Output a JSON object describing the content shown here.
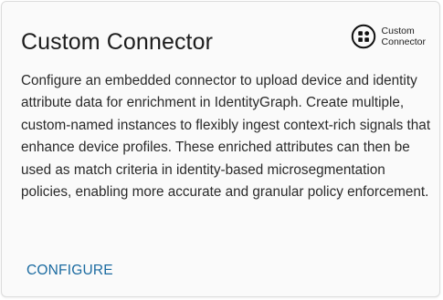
{
  "card": {
    "title": "Custom Connector",
    "badge": {
      "icon": "custom-connector-icon",
      "line1": "Custom",
      "line2": "Connector"
    },
    "description": "Configure an embedded connector to upload device and identity attribute data for enrichment in IdentityGraph. Create multiple, custom-named instances to flexibly ingest context-rich signals that enhance device profiles. These enriched attributes can then be used as match criteria in identity-based microsegmentation policies, enabling more accurate and granular policy enforcement.",
    "action_label": "CONFIGURE"
  },
  "colors": {
    "action": "#1a6aa0",
    "card_background": "#fafafa",
    "border": "#dcdcdc"
  }
}
